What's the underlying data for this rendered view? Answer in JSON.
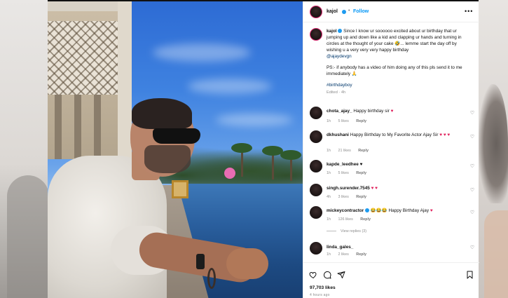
{
  "post": {
    "author": "kajol",
    "follow_label": "Follow",
    "more_label": "•••",
    "caption_author": "kajol",
    "caption_main": "Since I know ur soooooo excited about ur birthday that ur jumping up and down like a kid and clapping ur hands and turning in circles at the thought of your cake 🤣... lemme start the day off by wishing u a very very very happy birthday",
    "mention": "@ajaydevgn",
    "caption_ps": "PS:- if anybody has a video of him doing any of this pls send it to me immediately 🙏",
    "hashtag": "#birthdayboy",
    "edited_meta": "Edited · 4h",
    "likes": "97,703 likes",
    "time": "4 hours ago"
  },
  "comments": [
    {
      "user": "chota_ajay_",
      "text": "Happy birthday sir",
      "emoji": "♥",
      "time": "1h",
      "likes": "5 likes",
      "reply": "Reply"
    },
    {
      "user": "dkhushani",
      "text": "Happy Birthday to My Favorite Actor Ajay Sir",
      "emoji": "♥ ♥ ♥",
      "time": "1h",
      "likes": "21 likes",
      "reply": "Reply"
    },
    {
      "user": "kapde_leedhee",
      "text": "",
      "emoji": "♥",
      "time": "1h",
      "likes": "5 likes",
      "reply": "Reply"
    },
    {
      "user": "singh.surender.7545",
      "text": "",
      "emoji": "♥ ♥",
      "time": "4h",
      "likes": "3 likes",
      "reply": "Reply"
    },
    {
      "user": "mickeycontractor",
      "text": "😂😂😂 Happy Birthday Ajay",
      "emoji": "♥",
      "time": "1h",
      "likes": "126 likes",
      "reply": "Reply",
      "view_replies": "View replies (3)"
    },
    {
      "user": "linda_gales_",
      "text": "",
      "emoji": "",
      "time": "1h",
      "likes": "2 likes",
      "reply": "Reply"
    }
  ],
  "icons": {
    "like": "heart-outline-icon",
    "comment": "comment-icon",
    "share": "share-icon",
    "save": "bookmark-icon"
  },
  "colors": {
    "link": "#00376b",
    "follow": "#0095f6",
    "heart": "#e0245e",
    "verified": "#1d9bf0"
  }
}
